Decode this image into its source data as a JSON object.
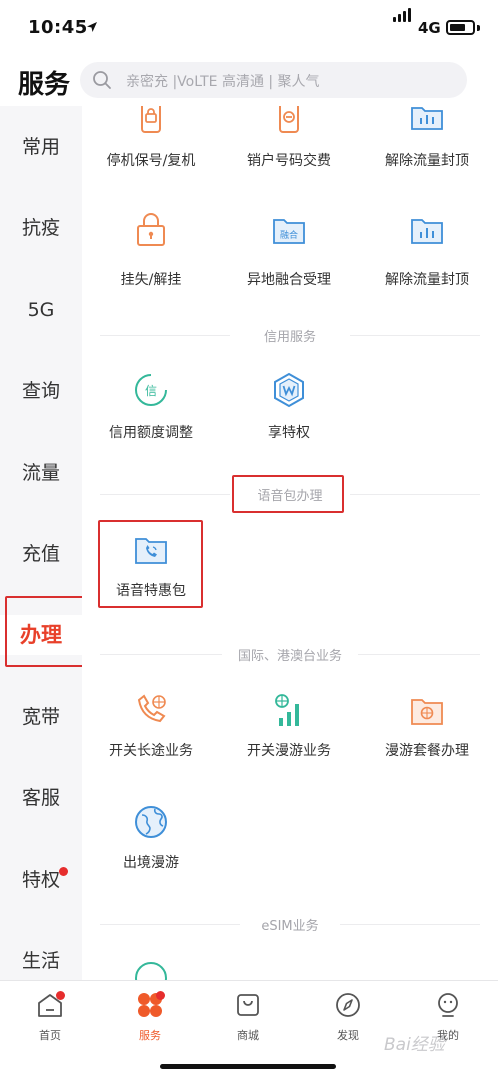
{
  "status_bar": {
    "time": "10:45",
    "network": "4G",
    "battery_level": 0.7
  },
  "header": {
    "title": "服务",
    "search_placeholder": "亲密充 |VoLTE 高清通 | 聚人气"
  },
  "sidebar": {
    "items": [
      {
        "label": "常用"
      },
      {
        "label": "抗疫"
      },
      {
        "label": "5G"
      },
      {
        "label": "查询"
      },
      {
        "label": "流量"
      },
      {
        "label": "充值"
      },
      {
        "label": "办理",
        "active": true
      },
      {
        "label": "宽带"
      },
      {
        "label": "客服"
      },
      {
        "label": "特权",
        "badge": true
      },
      {
        "label": "生活"
      }
    ]
  },
  "services": {
    "row1": [
      "停机保号/复机",
      "销户号码交费",
      "解除流量封顶"
    ],
    "row2": [
      "挂失/解挂",
      "异地融合受理",
      "解除流量封顶"
    ],
    "row2_icon_text": "融合",
    "credit_title": "信用服务",
    "credit_items": [
      "信用额度调整",
      "享特权"
    ],
    "credit_icon_text": "信",
    "voice_title": "语音包办理",
    "voice_items": [
      "语音特惠包"
    ],
    "intl_title": "国际、港澳台业务",
    "intl_row1": [
      "开关长途业务",
      "开关漫游业务",
      "漫游套餐办理"
    ],
    "intl_row2": [
      "出境漫游"
    ],
    "esim_title": "eSIM业务"
  },
  "tab_bar": {
    "tabs": [
      {
        "label": "首页",
        "badge": true
      },
      {
        "label": "服务",
        "active": true,
        "badge": true
      },
      {
        "label": "商城"
      },
      {
        "label": "发现"
      },
      {
        "label": "我的"
      }
    ]
  },
  "watermark": "Bai经验",
  "colors": {
    "accent": "#e8402a",
    "highlight": "#d92f2f",
    "orange_icon": "#ef8a52",
    "blue_icon": "#3f8fd8",
    "teal_icon": "#34b89a"
  }
}
